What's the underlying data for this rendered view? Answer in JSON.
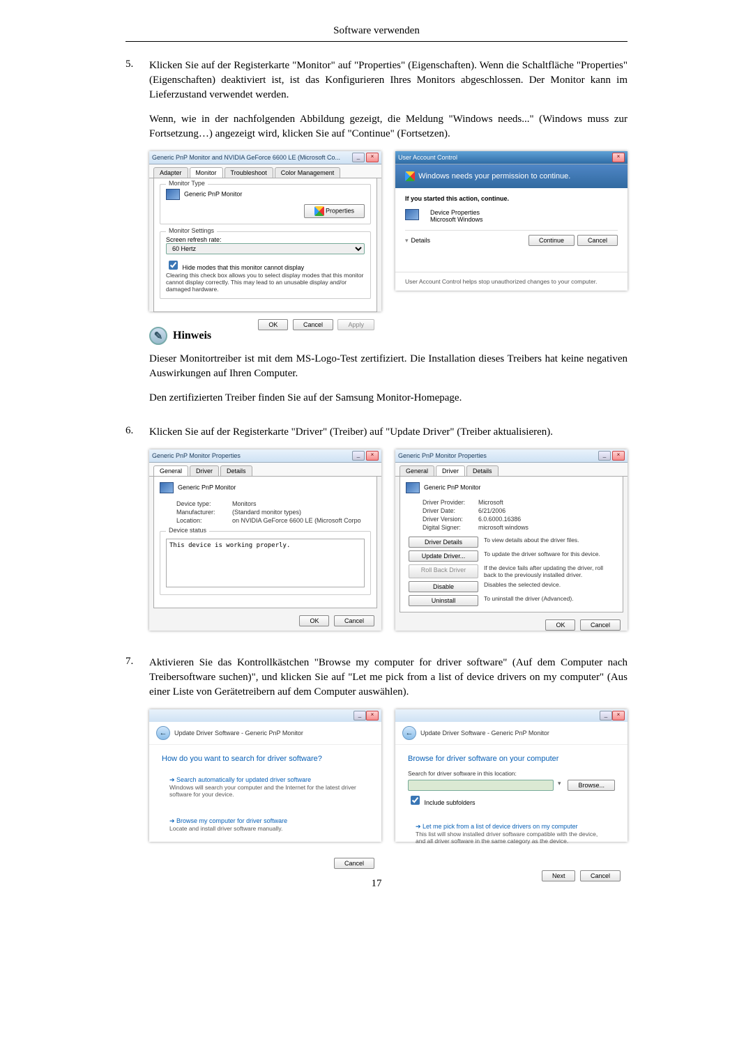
{
  "header": "Software verwenden",
  "page_number": "17",
  "step5": {
    "num": "5.",
    "para1": "Klicken Sie auf der Registerkarte \"Monitor\" auf \"Properties\" (Eigenschaften). Wenn die Schaltfläche \"Properties\" (Eigenschaften) deaktiviert ist, ist das Konfigurieren Ihres Monitors abgeschlossen. Der Monitor kann im Lieferzustand verwendet werden.",
    "para2": "Wenn, wie in der nachfolgenden Abbildung gezeigt, die Meldung \"Windows needs...\" (Windows muss zur Fortsetzung…) angezeigt wird, klicken Sie auf \"Continue\" (Fortsetzen)."
  },
  "props_dialog": {
    "title": "Generic PnP Monitor and NVIDIA GeForce 6600 LE (Microsoft Co...",
    "tabs": [
      "Adapter",
      "Monitor",
      "Troubleshoot",
      "Color Management"
    ],
    "monitor_type_legend": "Monitor Type",
    "monitor_name": "Generic PnP Monitor",
    "properties_btn": "Properties",
    "monitor_settings_legend": "Monitor Settings",
    "refresh_label": "Screen refresh rate:",
    "refresh_value": "60 Hertz",
    "hide_modes_chk": "Hide modes that this monitor cannot display",
    "hide_modes_desc": "Clearing this check box allows you to select display modes that this monitor cannot display correctly. This may lead to an unusable display and/or damaged hardware.",
    "ok": "OK",
    "cancel": "Cancel",
    "apply": "Apply"
  },
  "uac_dialog": {
    "title": "User Account Control",
    "banner": "Windows needs your permission to continue.",
    "started": "If you started this action, continue.",
    "item_title": "Device Properties",
    "item_publisher": "Microsoft Windows",
    "details": "Details",
    "continue": "Continue",
    "cancel": "Cancel",
    "foot": "User Account Control helps stop unauthorized changes to your computer."
  },
  "hinweis_label": "Hinweis",
  "hinweis_p1": "Dieser Monitortreiber ist mit dem MS-Logo-Test zertifiziert. Die Installation dieses Treibers hat keine negativen Auswirkungen auf Ihren Computer.",
  "hinweis_p2": "Den zertifizierten Treiber finden Sie auf der Samsung Monitor-Homepage.",
  "step6": {
    "num": "6.",
    "para": "Klicken Sie auf der Registerkarte \"Driver\" (Treiber) auf \"Update Driver\" (Treiber aktualisieren)."
  },
  "gen_dialog": {
    "title": "Generic PnP Monitor Properties",
    "tabs": [
      "General",
      "Driver",
      "Details"
    ],
    "name": "Generic PnP Monitor",
    "kv": {
      "device_type_k": "Device type:",
      "device_type_v": "Monitors",
      "manufacturer_k": "Manufacturer:",
      "manufacturer_v": "(Standard monitor types)",
      "location_k": "Location:",
      "location_v": "on NVIDIA GeForce 6600 LE (Microsoft Corpo"
    },
    "device_status_legend": "Device status",
    "device_status_text": "This device is working properly.",
    "ok": "OK",
    "cancel": "Cancel"
  },
  "drv_dialog": {
    "title": "Generic PnP Monitor Properties",
    "tabs": [
      "General",
      "Driver",
      "Details"
    ],
    "name": "Generic PnP Monitor",
    "kv": {
      "provider_k": "Driver Provider:",
      "provider_v": "Microsoft",
      "date_k": "Driver Date:",
      "date_v": "6/21/2006",
      "version_k": "Driver Version:",
      "version_v": "6.0.6000.16386",
      "signer_k": "Digital Signer:",
      "signer_v": "microsoft windows"
    },
    "buttons": {
      "details": "Driver Details",
      "details_desc": "To view details about the driver files.",
      "update": "Update Driver...",
      "update_desc": "To update the driver software for this device.",
      "rollback": "Roll Back Driver",
      "rollback_desc": "If the device fails after updating the driver, roll back to the previously installed driver.",
      "disable": "Disable",
      "disable_desc": "Disables the selected device.",
      "uninstall": "Uninstall",
      "uninstall_desc": "To uninstall the driver (Advanced)."
    },
    "ok": "OK",
    "cancel": "Cancel"
  },
  "step7": {
    "num": "7.",
    "para": "Aktivieren Sie das Kontrollkästchen \"Browse my computer for driver software\" (Auf dem Computer nach Treibersoftware suchen)\", und klicken Sie auf \"Let me pick from a list of device drivers on my computer\" (Aus einer Liste von Gerätetreibern auf dem Computer auswählen)."
  },
  "wizard1": {
    "title": "Update Driver Software - Generic PnP Monitor",
    "heading": "How do you want to search for driver software?",
    "opt1_t": "Search automatically for updated driver software",
    "opt1_d": "Windows will search your computer and the Internet for the latest driver software for your device.",
    "opt2_t": "Browse my computer for driver software",
    "opt2_d": "Locate and install driver software manually.",
    "cancel": "Cancel"
  },
  "wizard2": {
    "title": "Update Driver Software - Generic PnP Monitor",
    "heading": "Browse for driver software on your computer",
    "search_label": "Search for driver software in this location:",
    "browse": "Browse...",
    "include_sub": "Include subfolders",
    "opt_t": "Let me pick from a list of device drivers on my computer",
    "opt_d": "This list will show installed driver software compatible with the device, and all driver software in the same category as the device.",
    "next": "Next",
    "cancel": "Cancel"
  }
}
